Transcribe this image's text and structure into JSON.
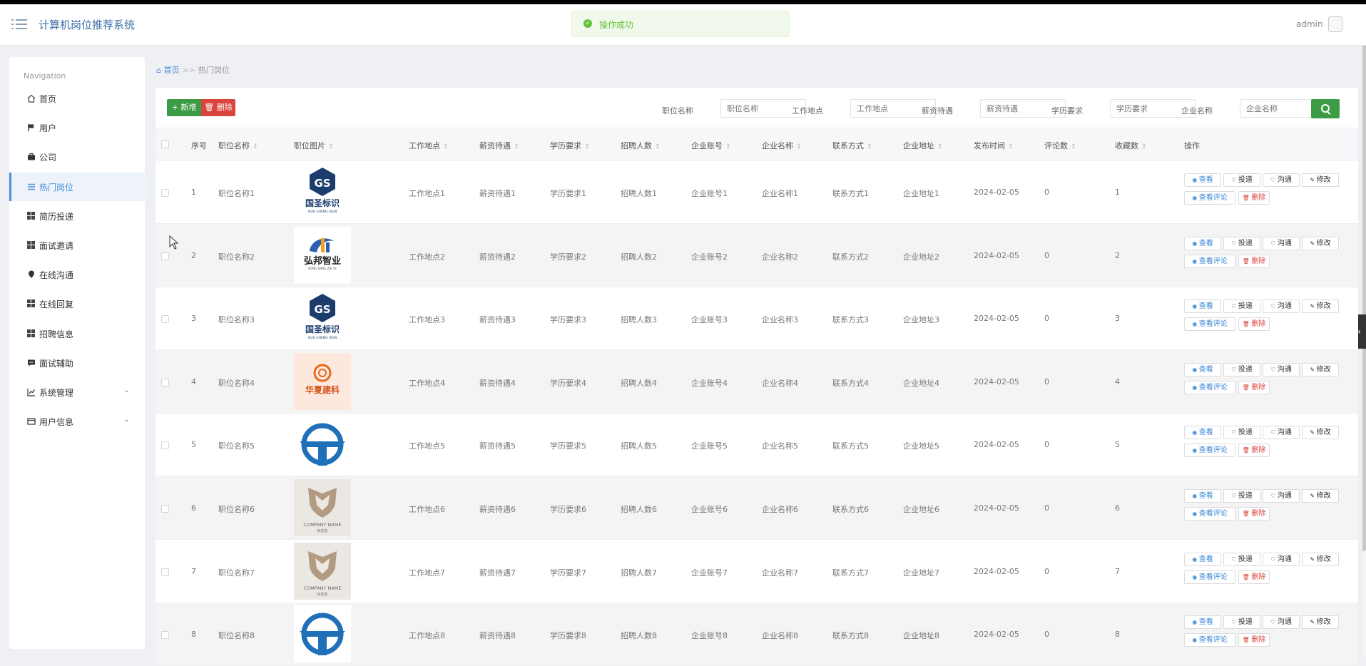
{
  "app": {
    "title": "计算机岗位推荐系统",
    "user": "admin",
    "toast": "操作成功"
  },
  "sidebar": {
    "caption": "Navigation",
    "items": [
      {
        "label": "首页",
        "icon": "home-icon"
      },
      {
        "label": "用户",
        "icon": "flag-icon"
      },
      {
        "label": "公司",
        "icon": "briefcase-icon"
      },
      {
        "label": "热门岗位",
        "icon": "list-icon",
        "active": true
      },
      {
        "label": "简历投递",
        "icon": "grid-icon"
      },
      {
        "label": "面试邀请",
        "icon": "grid-icon"
      },
      {
        "label": "在线沟通",
        "icon": "pin-icon"
      },
      {
        "label": "在线回复",
        "icon": "grid-icon"
      },
      {
        "label": "招聘信息",
        "icon": "grid-icon"
      },
      {
        "label": "面试辅助",
        "icon": "chat-icon"
      },
      {
        "label": "系统管理",
        "icon": "chart-icon",
        "expandable": true
      },
      {
        "label": "用户信息",
        "icon": "card-icon",
        "expandable": true
      }
    ]
  },
  "breadcrumb": {
    "home": "首页",
    "sep": ">>",
    "current": "热门岗位"
  },
  "toolbar": {
    "add": "新增",
    "delete": "删除",
    "filters": [
      {
        "label": "职位名称",
        "placeholder": "职位名称"
      },
      {
        "label": "工作地点",
        "placeholder": "工作地点"
      },
      {
        "label": "薪资待遇",
        "placeholder": "薪资待遇"
      },
      {
        "label": "学历要求",
        "placeholder": "学历要求"
      },
      {
        "label": "企业名称",
        "placeholder": "企业名称"
      }
    ]
  },
  "table": {
    "columns": [
      "序号",
      "职位名称",
      "职位图片",
      "工作地点",
      "薪资待遇",
      "学历要求",
      "招聘人数",
      "企业账号",
      "企业名称",
      "联系方式",
      "企业地址",
      "发布时间",
      "评论数",
      "收藏数",
      "操作"
    ],
    "actions": {
      "view": "查看",
      "apply": "投递",
      "chat": "沟通",
      "edit": "修改",
      "comments": "查看评论",
      "delete": "删除"
    },
    "rows": [
      {
        "no": "1",
        "name": "职位名称1",
        "logo": "guosheng",
        "place": "工作地点1",
        "salary": "薪资待遇1",
        "edu": "学历要求1",
        "count": "招聘人数1",
        "account": "企业账号1",
        "company": "企业名称1",
        "contact": "联系方式1",
        "address": "企业地址1",
        "date": "2024-02-05",
        "comments": "0",
        "favs": "1"
      },
      {
        "no": "2",
        "name": "职位名称2",
        "logo": "hongbang",
        "place": "工作地点2",
        "salary": "薪资待遇2",
        "edu": "学历要求2",
        "count": "招聘人数2",
        "account": "企业账号2",
        "company": "企业名称2",
        "contact": "联系方式2",
        "address": "企业地址2",
        "date": "2024-02-05",
        "comments": "0",
        "favs": "2"
      },
      {
        "no": "3",
        "name": "职位名称3",
        "logo": "guosheng",
        "place": "工作地点3",
        "salary": "薪资待遇3",
        "edu": "学历要求3",
        "count": "招聘人数3",
        "account": "企业账号3",
        "company": "企业名称3",
        "contact": "联系方式3",
        "address": "企业地址3",
        "date": "2024-02-05",
        "comments": "0",
        "favs": "3"
      },
      {
        "no": "4",
        "name": "职位名称4",
        "logo": "huaxia",
        "place": "工作地点4",
        "salary": "薪资待遇4",
        "edu": "学历要求4",
        "count": "招聘人数4",
        "account": "企业账号4",
        "company": "企业名称4",
        "contact": "联系方式4",
        "address": "企业地址4",
        "date": "2024-02-05",
        "comments": "0",
        "favs": "4"
      },
      {
        "no": "5",
        "name": "职位名称5",
        "logo": "blue-t",
        "place": "工作地点5",
        "salary": "薪资待遇5",
        "edu": "学历要求5",
        "count": "招聘人数5",
        "account": "企业账号5",
        "company": "企业名称5",
        "contact": "联系方式5",
        "address": "企业地址5",
        "date": "2024-02-05",
        "comments": "0",
        "favs": "5"
      },
      {
        "no": "6",
        "name": "职位名称6",
        "logo": "shield",
        "place": "工作地点6",
        "salary": "薪资待遇6",
        "edu": "学历要求6",
        "count": "招聘人数6",
        "account": "企业账号6",
        "company": "企业名称6",
        "contact": "联系方式6",
        "address": "企业地址6",
        "date": "2024-02-05",
        "comments": "0",
        "favs": "6"
      },
      {
        "no": "7",
        "name": "职位名称7",
        "logo": "shield",
        "place": "工作地点7",
        "salary": "薪资待遇7",
        "edu": "学历要求7",
        "count": "招聘人数7",
        "account": "企业账号7",
        "company": "企业名称7",
        "contact": "联系方式7",
        "address": "企业地址7",
        "date": "2024-02-05",
        "comments": "0",
        "favs": "7"
      },
      {
        "no": "8",
        "name": "职位名称8",
        "logo": "blue-t",
        "place": "工作地点8",
        "salary": "薪资待遇8",
        "edu": "学历要求8",
        "count": "招聘人数8",
        "account": "企业账号8",
        "company": "企业名称8",
        "contact": "联系方式8",
        "address": "企业地址8",
        "date": "2024-02-05",
        "comments": "0",
        "favs": "8"
      }
    ]
  },
  "logos": {
    "guosheng": {
      "main": "国圣标识",
      "sub": "GUO SHENG SIGN"
    },
    "hongbang": {
      "main": "弘邦智业",
      "sub": "HONG BANG ZHI YE"
    },
    "huaxia": {
      "main": "华夏建科"
    },
    "shield": {
      "main": "COMPANY NAME",
      "sub": "标志名"
    }
  },
  "colors": {
    "accent": "#4a90d9",
    "success": "#3c9b45",
    "danger": "#d9443c"
  }
}
